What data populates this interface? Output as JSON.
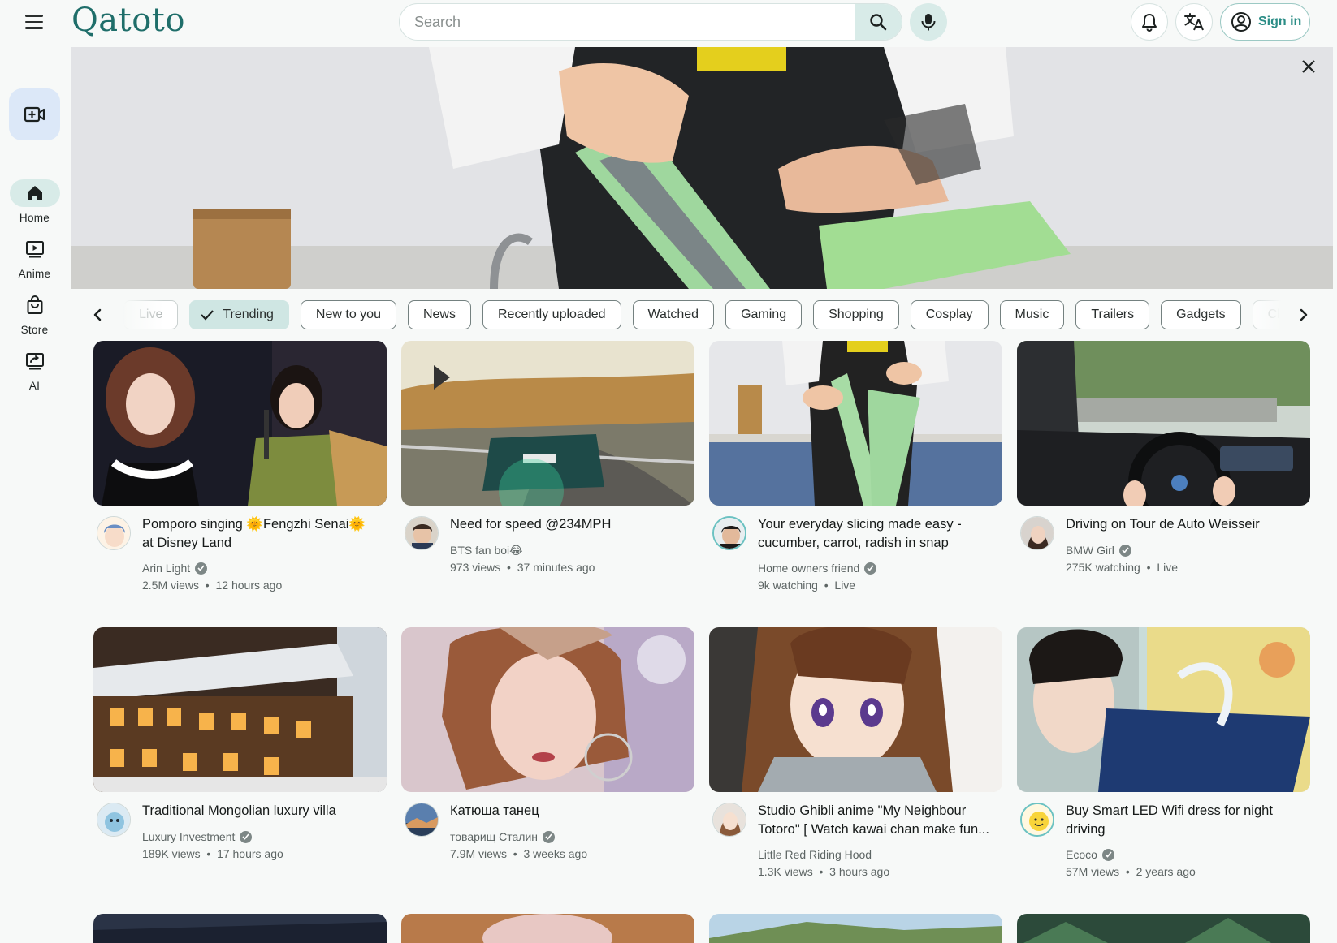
{
  "app": {
    "name": "Qatoto"
  },
  "header": {
    "search_placeholder": "Search",
    "sign_in_label": "Sign in"
  },
  "sidebar": {
    "items": [
      {
        "label": "Home",
        "icon": "home-icon",
        "active": true
      },
      {
        "label": "Anime",
        "icon": "play-screen-icon",
        "active": false
      },
      {
        "label": "Store",
        "icon": "shopping-bag-icon",
        "active": false
      },
      {
        "label": "AI",
        "icon": "ai-screen-icon",
        "active": false
      }
    ]
  },
  "chips": [
    {
      "label": "Live",
      "state": "faded"
    },
    {
      "label": "Trending",
      "state": "selected"
    },
    {
      "label": "New to you",
      "state": "normal"
    },
    {
      "label": "News",
      "state": "normal"
    },
    {
      "label": "Recently uploaded",
      "state": "normal"
    },
    {
      "label": "Watched",
      "state": "normal"
    },
    {
      "label": "Gaming",
      "state": "normal"
    },
    {
      "label": "Shopping",
      "state": "normal"
    },
    {
      "label": "Cosplay",
      "state": "normal"
    },
    {
      "label": "Music",
      "state": "normal"
    },
    {
      "label": "Trailers",
      "state": "normal"
    },
    {
      "label": "Gadgets",
      "state": "normal"
    },
    {
      "label": "Cl",
      "state": "faded"
    }
  ],
  "videos": [
    {
      "title": "Pomporo singing 🌞Fengzhi Senai🌞 at Disney Land",
      "channel": "Arin Light",
      "verified": true,
      "views": "2.5M views",
      "age": "12 hours ago"
    },
    {
      "title": "Need for speed @234MPH",
      "channel": "BTS fan boi😂",
      "verified": false,
      "views": "973 views",
      "age": "37 minutes ago"
    },
    {
      "title": "Your everyday slicing made easy - cucumber, carrot, radish in snap",
      "channel": "Home owners friend",
      "verified": true,
      "views": "9k watching",
      "age": "Live"
    },
    {
      "title": "Driving on Tour de Auto Weisseir",
      "channel": "BMW Girl",
      "verified": true,
      "views": "275K watching",
      "age": "Live"
    },
    {
      "title": "Traditional Mongolian luxury villa",
      "channel": "Luxury Investment",
      "verified": true,
      "views": "189K views",
      "age": "17 hours ago"
    },
    {
      "title": "Катюша танец",
      "channel": "товарищ Сталин",
      "verified": true,
      "views": "7.9M views",
      "age": "3 weeks ago"
    },
    {
      "title": "Studio Ghibli anime \"My Neighbour Totoro\" [ Watch kawai chan make fun...",
      "channel": "Little Red Riding Hood",
      "verified": false,
      "views": "1.3K views",
      "age": "3 hours ago"
    },
    {
      "title": "Buy Smart LED Wifi dress for night driving",
      "channel": "Ecoco",
      "verified": true,
      "views": "57M views",
      "age": "2 years ago"
    }
  ]
}
